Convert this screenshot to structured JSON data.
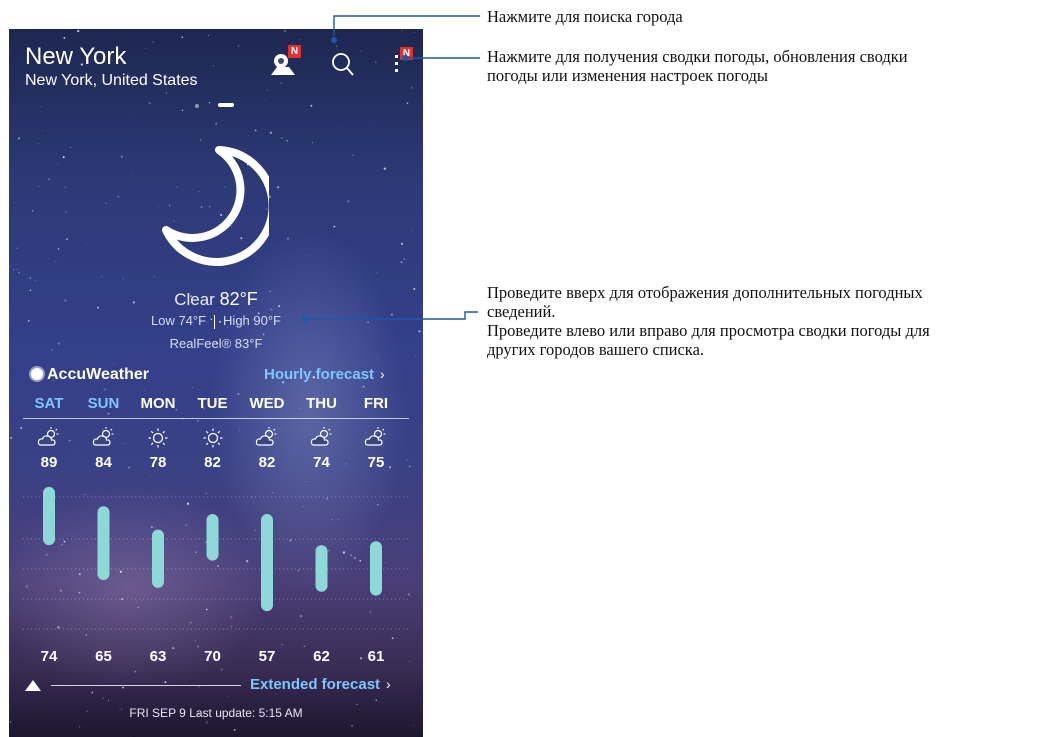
{
  "header": {
    "city": "New York",
    "region": "New York, United States",
    "badge": "N"
  },
  "current": {
    "condition": "Clear",
    "temp": "82°F",
    "low": "Low 74°F",
    "high": "High 90°F",
    "realfeel": "RealFeel® 83°F"
  },
  "provider": {
    "name": "AccuWeather",
    "hourly_link": "Hourly forecast"
  },
  "days": [
    {
      "label": "SAT",
      "high": "89",
      "low": "74",
      "icon": "partly-cloudy-icon",
      "hi_val": 89,
      "lo_val": 74,
      "weekend": true
    },
    {
      "label": "SUN",
      "high": "84",
      "low": "65",
      "icon": "partly-cloudy-icon",
      "hi_val": 84,
      "lo_val": 65,
      "weekend": true
    },
    {
      "label": "MON",
      "high": "78",
      "low": "63",
      "icon": "sunny-icon",
      "hi_val": 78,
      "lo_val": 63,
      "weekend": false
    },
    {
      "label": "TUE",
      "high": "82",
      "low": "70",
      "icon": "sunny-icon",
      "hi_val": 82,
      "lo_val": 70,
      "weekend": false
    },
    {
      "label": "WED",
      "high": "82",
      "low": "57",
      "icon": "partly-cloudy-icon",
      "hi_val": 82,
      "lo_val": 57,
      "weekend": false
    },
    {
      "label": "THU",
      "high": "74",
      "low": "62",
      "icon": "partly-cloudy-icon",
      "hi_val": 74,
      "lo_val": 62,
      "weekend": false
    },
    {
      "label": "FRI",
      "high": "75",
      "low": "61",
      "icon": "partly-cloudy-icon",
      "hi_val": 75,
      "lo_val": 61,
      "weekend": false
    }
  ],
  "footer": {
    "extended_link": "Extended forecast",
    "last_update": "FRI SEP 9 Last update: 5:15 AM"
  },
  "annotations": {
    "search": "Нажмите для поиска города",
    "menu_line1": "Нажмите для получения сводки погоды, обновления сводки",
    "menu_line2": "погоды или изменения настроек погоды",
    "swipe_line1": "Проведите вверх для отображения дополнительных погодных",
    "swipe_line2": "сведений.",
    "swipe_line3": "Проведите влево или вправо для просмотра сводки погоды для",
    "swipe_line4": "других городов вашего списка."
  },
  "colors": {
    "bar": "#8ed8d8",
    "weekend": "#7dc6ff",
    "link": "#7dc6ff",
    "badge": "#e3302f"
  }
}
